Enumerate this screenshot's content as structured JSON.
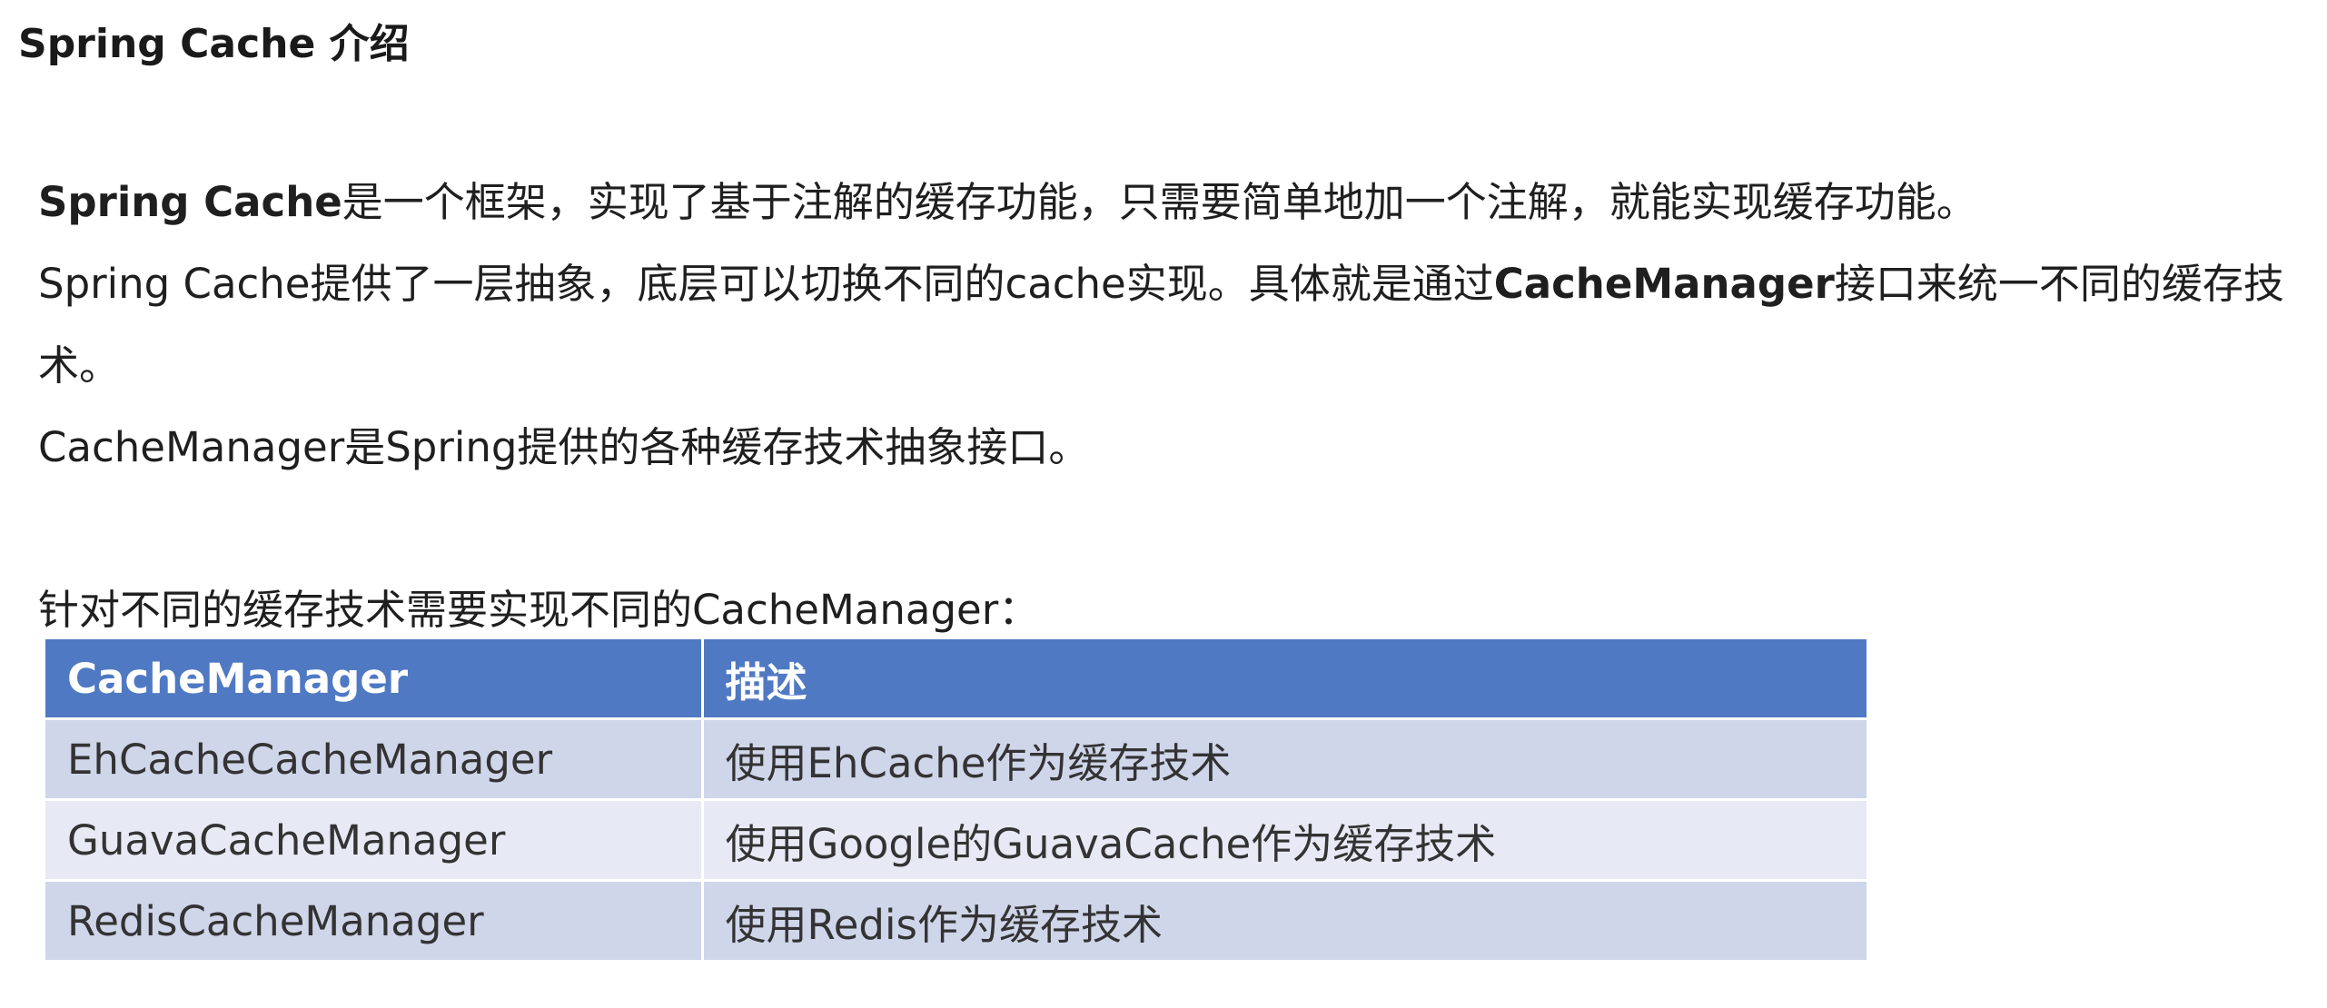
{
  "title": "Spring Cache 介绍",
  "paragraphs": {
    "p1_bold": "Spring Cache",
    "p1_rest": "是一个框架，实现了基于注解的缓存功能，只需要简单地加一个注解，就能实现缓存功能。",
    "p2_start": "Spring Cache提供了一层抽象，底层可以切换不同的cache实现。具体就是通过",
    "p2_bold": "CacheManager",
    "p2_end": "接口来统一不同的缓存技术。",
    "p3": "CacheManager是Spring提供的各种缓存技术抽象接口。",
    "p4": "针对不同的缓存技术需要实现不同的CacheManager："
  },
  "table": {
    "headers": [
      "CacheManager",
      "描述"
    ],
    "rows": [
      [
        "EhCacheCacheManager",
        "使用EhCache作为缓存技术"
      ],
      [
        "GuavaCacheManager",
        "使用Google的GuavaCache作为缓存技术"
      ],
      [
        "RedisCacheManager",
        "使用Redis作为缓存技术"
      ]
    ]
  }
}
